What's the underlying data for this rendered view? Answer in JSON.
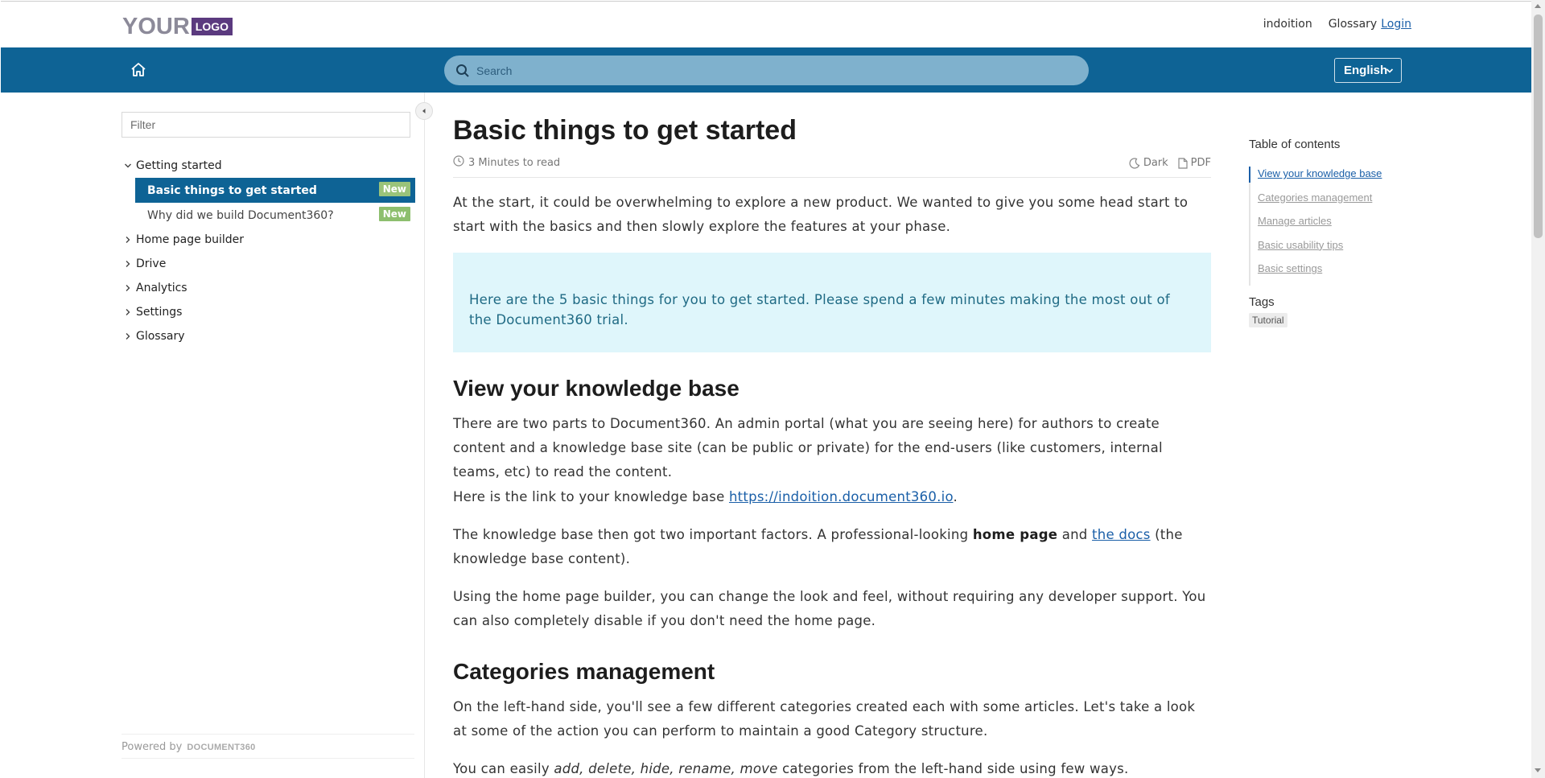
{
  "header": {
    "logo_text": "YOUR",
    "logo_box": "LOGO",
    "links": [
      "indoition",
      "Glossary"
    ],
    "login": "Login"
  },
  "navbar": {
    "search_placeholder": "Search",
    "language": "English",
    "icons": [
      "home-icon",
      "search-icon",
      "chevron-down-icon"
    ]
  },
  "sidebar": {
    "filter_placeholder": "Filter",
    "categories": [
      {
        "label": "Getting started",
        "expanded": true,
        "articles": [
          {
            "label": "Basic things to get started",
            "badge": "New",
            "active": true
          },
          {
            "label": "Why did we build Document360?",
            "badge": "New",
            "active": false
          }
        ]
      },
      {
        "label": "Home page builder",
        "expanded": false
      },
      {
        "label": "Drive",
        "expanded": false
      },
      {
        "label": "Analytics",
        "expanded": false
      },
      {
        "label": "Settings",
        "expanded": false
      },
      {
        "label": "Glossary",
        "expanded": false
      }
    ],
    "powered_by": "Powered by",
    "powered_brand": "DOCUMENT360"
  },
  "article": {
    "title": "Basic things to get started",
    "read_time": "3 Minutes to read",
    "dark_label": "Dark",
    "pdf_label": "PDF",
    "intro": "At the start, it could be overwhelming to explore a new product. We wanted to give you some head start to start with the basics and then slowly explore the features at your phase.",
    "callout": "Here are the 5 basic things for you to get started. Please spend a few minutes making the most out of the Document360 trial.",
    "h2_kb": "View your knowledge base",
    "kb_p1": "There are two parts to Document360. An admin portal (what you are seeing here) for authors to create content and a knowledge base site (can be public or private) for the end-users (like customers, internal teams, etc) to read the content.",
    "kb_p2_pre": "Here is the link to your knowledge base ",
    "kb_link": "https://indoition.document360.io",
    "kb_p2_post": ".",
    "kb_p3_a": "The knowledge base then got two important factors. A professional-looking ",
    "kb_p3_bold": "home page",
    "kb_p3_b": " and ",
    "kb_p3_link": "the docs",
    "kb_p3_c": " (the knowledge base content).",
    "kb_p4": "Using the home page builder, you can change the look and feel, without requiring any developer support. You can also completely disable if you don't need the home page.",
    "h2_cat": "Categories management",
    "cat_p1": "On the left-hand side, you'll see a few different categories created each with some articles. Let's take a look at some of the action you can perform to maintain a good Category structure.",
    "cat_p2_a": "You can easily ",
    "cat_p2_em": "add, delete, hide, rename, move",
    "cat_p2_b": " categories from the left-hand side using few ways."
  },
  "toc": {
    "title": "Table of contents",
    "items": [
      "View your knowledge base",
      "Categories management",
      "Manage articles",
      "Basic usability tips",
      "Basic settings"
    ],
    "active_index": 0,
    "tags_title": "Tags",
    "tags": [
      "Tutorial"
    ]
  },
  "colors": {
    "navbar": "#0e6395",
    "search_bg": "#7fb1cd",
    "badge_new": "#8dbf6e",
    "callout_bg": "#dff6fb",
    "link": "#1a5fa8",
    "logo_purple": "#5b3a7f"
  }
}
